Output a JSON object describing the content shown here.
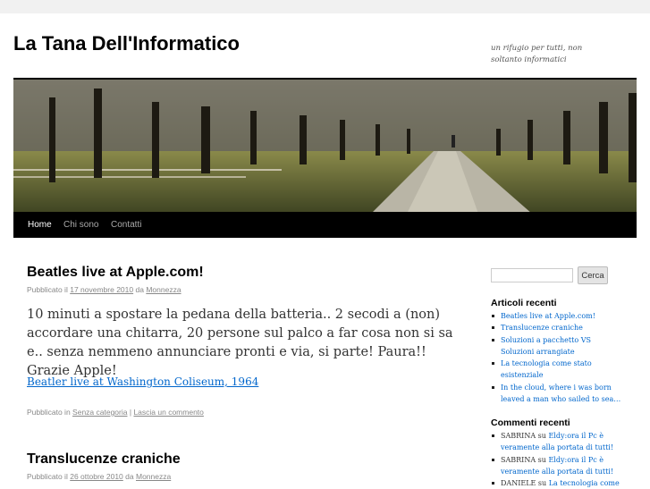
{
  "site": {
    "title": "La Tana Dell'Informatico",
    "description": "un rifugio per tutti, non soltanto informatici"
  },
  "nav": [
    {
      "label": "Home"
    },
    {
      "label": "Chi sono"
    },
    {
      "label": "Contatti"
    }
  ],
  "posts": [
    {
      "title": "Beatles live at Apple.com!",
      "meta": {
        "prefix": "Pubblicato il",
        "date": "17 novembre 2010",
        "by": "da",
        "author": "Monnezza"
      },
      "content": "10 minuti a spostare la pedana della batteria.. 2 secodi a (non) accordare una chitarra, 20 persone sul palco a far cosa non si sa e.. senza nemmeno annunciare pronti e via, si parte! Paura!! Grazie Apple!",
      "link": "Beatler live at Washington Coliseum, 1964",
      "footer": {
        "prefix": "Pubblicato in",
        "category": "Senza categoria",
        "sep": "|",
        "comment": "Lascia un commento"
      }
    },
    {
      "title": "Translucenze craniche",
      "meta": {
        "prefix": "Pubblicato il",
        "date": "26 ottobre 2010",
        "by": "da",
        "author": "Monnezza"
      }
    }
  ],
  "sidebar": {
    "search_button": "Cerca",
    "recent_posts_title": "Articoli recenti",
    "recent_posts": [
      "Beatles live at Apple.com!",
      "Translucenze craniche",
      "Soluzioni a pacchetto VS Soluzioni arrangiate",
      "La tecnologia come stato esistenziale",
      "In the cloud, where i was born leaved a man who sailed to sea…"
    ],
    "recent_comments_title": "Commenti recenti",
    "recent_comments": [
      {
        "author": "SABRINA",
        "on": "su",
        "post": "Eldy:ora il Pc è veramente alla portata di tutti!"
      },
      {
        "author": "SABRINA",
        "on": "su",
        "post": "Eldy:ora il Pc è veramente alla portata di tutti!"
      },
      {
        "author": "DANIELE",
        "on": "su",
        "post": "La tecnologia come"
      }
    ]
  },
  "colors": {
    "link": "#0066cc",
    "nav_bg": "#000000",
    "meta": "#888888"
  }
}
